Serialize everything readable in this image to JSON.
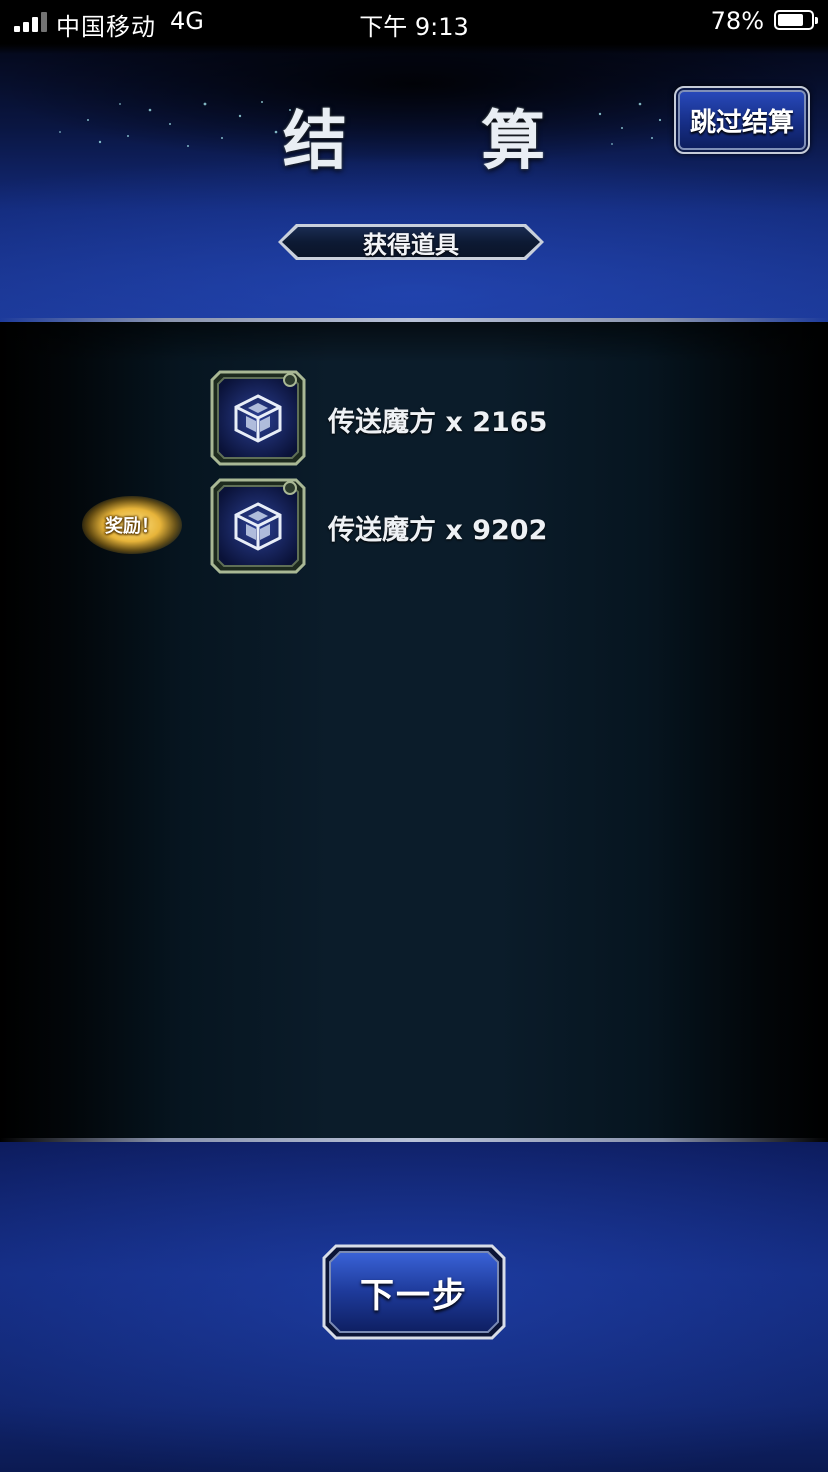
{
  "status_bar": {
    "carrier": "中国移动",
    "network": "4G",
    "time": "下午 9:13",
    "battery": "78%",
    "battery_level_fraction": 0.78
  },
  "header": {
    "title": "结 算",
    "skip_button": "跳过结算",
    "subtitle": "获得道具"
  },
  "items": [
    {
      "icon": "teleport-cube-icon",
      "label": "传送魔方 x 2165"
    },
    {
      "icon": "teleport-cube-icon",
      "label": "传送魔方 x 9202"
    }
  ],
  "reward_badge": "奖励！",
  "footer": {
    "next_button": "下一步"
  },
  "colors": {
    "header_blue": "#132a7a",
    "panel_dark": "#0b1c2a",
    "button_blue": "#1e3a9a",
    "badge_gold": "#e7b43a",
    "icon_frame_green": "#9fb08a"
  }
}
